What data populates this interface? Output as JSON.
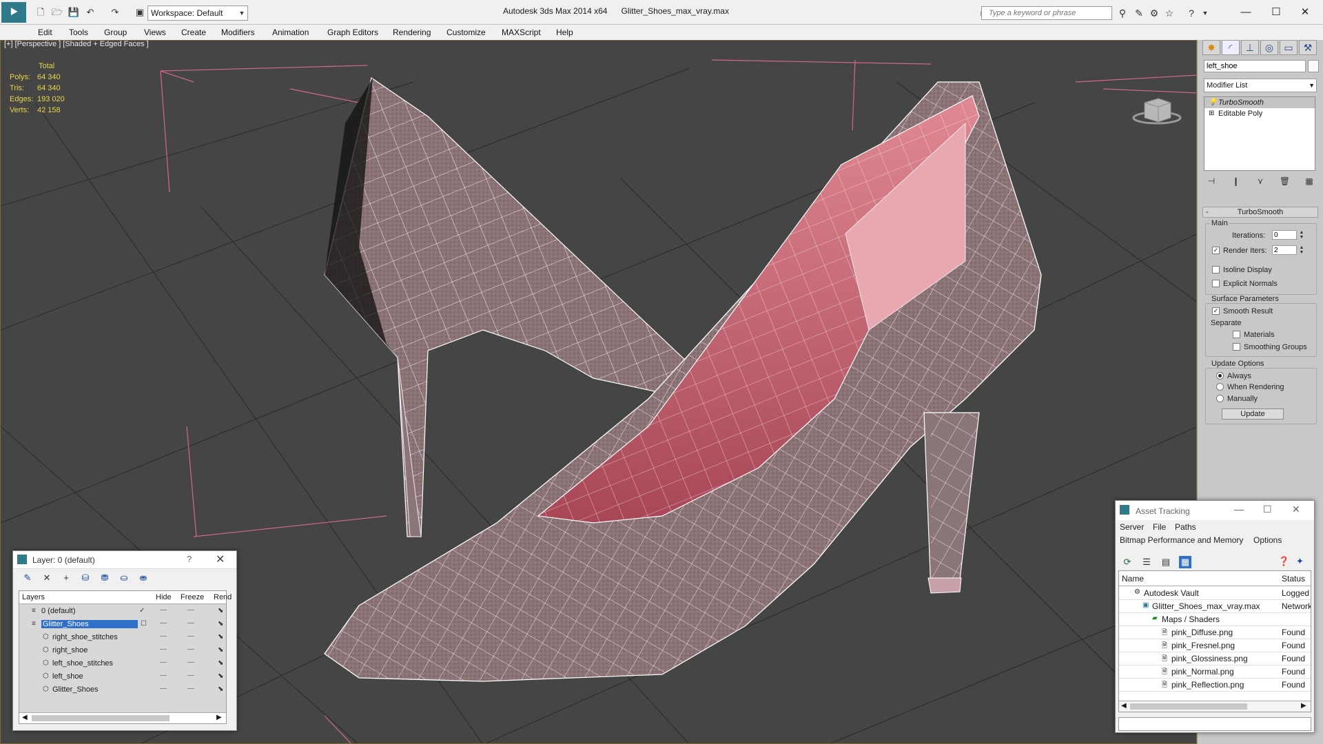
{
  "titlebar": {
    "workspace": "Workspace: Default",
    "app_title": "Autodesk 3ds Max  2014 x64",
    "file_name": "Glitter_Shoes_max_vray.max",
    "search_placeholder": "Type a keyword or phrase"
  },
  "menu": [
    "Edit",
    "Tools",
    "Group",
    "Views",
    "Create",
    "Modifiers",
    "Animation",
    "Graph Editors",
    "Rendering",
    "Customize",
    "MAXScript",
    "Help"
  ],
  "viewport": {
    "label": "[+] [Perspective ] [Shaded + Edged Faces ]",
    "stats": {
      "header": "Total",
      "rows": [
        {
          "k": "Polys:",
          "v": "64 340"
        },
        {
          "k": "Tris:",
          "v": "64 340"
        },
        {
          "k": "Edges:",
          "v": "193 020"
        },
        {
          "k": "Verts:",
          "v": "42 158"
        }
      ]
    },
    "colors": {
      "background": "#454545",
      "shoe": "#8a7275",
      "lining": "#d2707a",
      "wire": "#f4e6ee",
      "grid": "#2a2a2a",
      "selection": "#d06a8a"
    }
  },
  "command_panel": {
    "object_name": "left_shoe",
    "modifier_list": "Modifier List",
    "stack": [
      "TurboSmooth",
      "Editable Poly"
    ],
    "rollout_title": "TurboSmooth",
    "main_label": "Main",
    "iterations_label": "Iterations:",
    "iterations_value": "0",
    "render_iters_label": "Render Iters:",
    "render_iters_value": "2",
    "isoline_label": "Isoline Display",
    "explicit_label": "Explicit Normals",
    "surface_label": "Surface Parameters",
    "smooth_result_label": "Smooth Result",
    "separate_label": "Separate",
    "materials_label": "Materials",
    "smoothing_groups_label": "Smoothing Groups",
    "update_options_label": "Update Options",
    "always_label": "Always",
    "when_rendering_label": "When Rendering",
    "manually_label": "Manually",
    "update_button": "Update"
  },
  "layer_window": {
    "title": "Layer: 0 (default)",
    "columns": [
      "Layers",
      "Hide",
      "Freeze",
      "Rend"
    ],
    "rows": [
      {
        "name": "0 (default)"
      },
      {
        "name": "Glitter_Shoes"
      },
      {
        "name": "right_shoe_stitches"
      },
      {
        "name": "right_shoe"
      },
      {
        "name": "left_shoe_stitches"
      },
      {
        "name": "left_shoe"
      },
      {
        "name": "Glitter_Shoes"
      }
    ]
  },
  "asset_window": {
    "title": "Asset Tracking",
    "menu1": [
      "Server",
      "File",
      "Paths"
    ],
    "menu2": [
      "Bitmap Performance and Memory",
      "Options"
    ],
    "columns": [
      "Name",
      "Status"
    ],
    "rows": [
      {
        "name": "Autodesk Vault",
        "status": "Logged"
      },
      {
        "name": "Glitter_Shoes_max_vray.max",
        "status": "Network"
      },
      {
        "name": "Maps / Shaders",
        "status": ""
      },
      {
        "name": "pink_Diffuse.png",
        "status": "Found"
      },
      {
        "name": "pink_Fresnel.png",
        "status": "Found"
      },
      {
        "name": "pink_Glossiness.png",
        "status": "Found"
      },
      {
        "name": "pink_Normal.png",
        "status": "Found"
      },
      {
        "name": "pink_Reflection.png",
        "status": "Found"
      }
    ]
  }
}
